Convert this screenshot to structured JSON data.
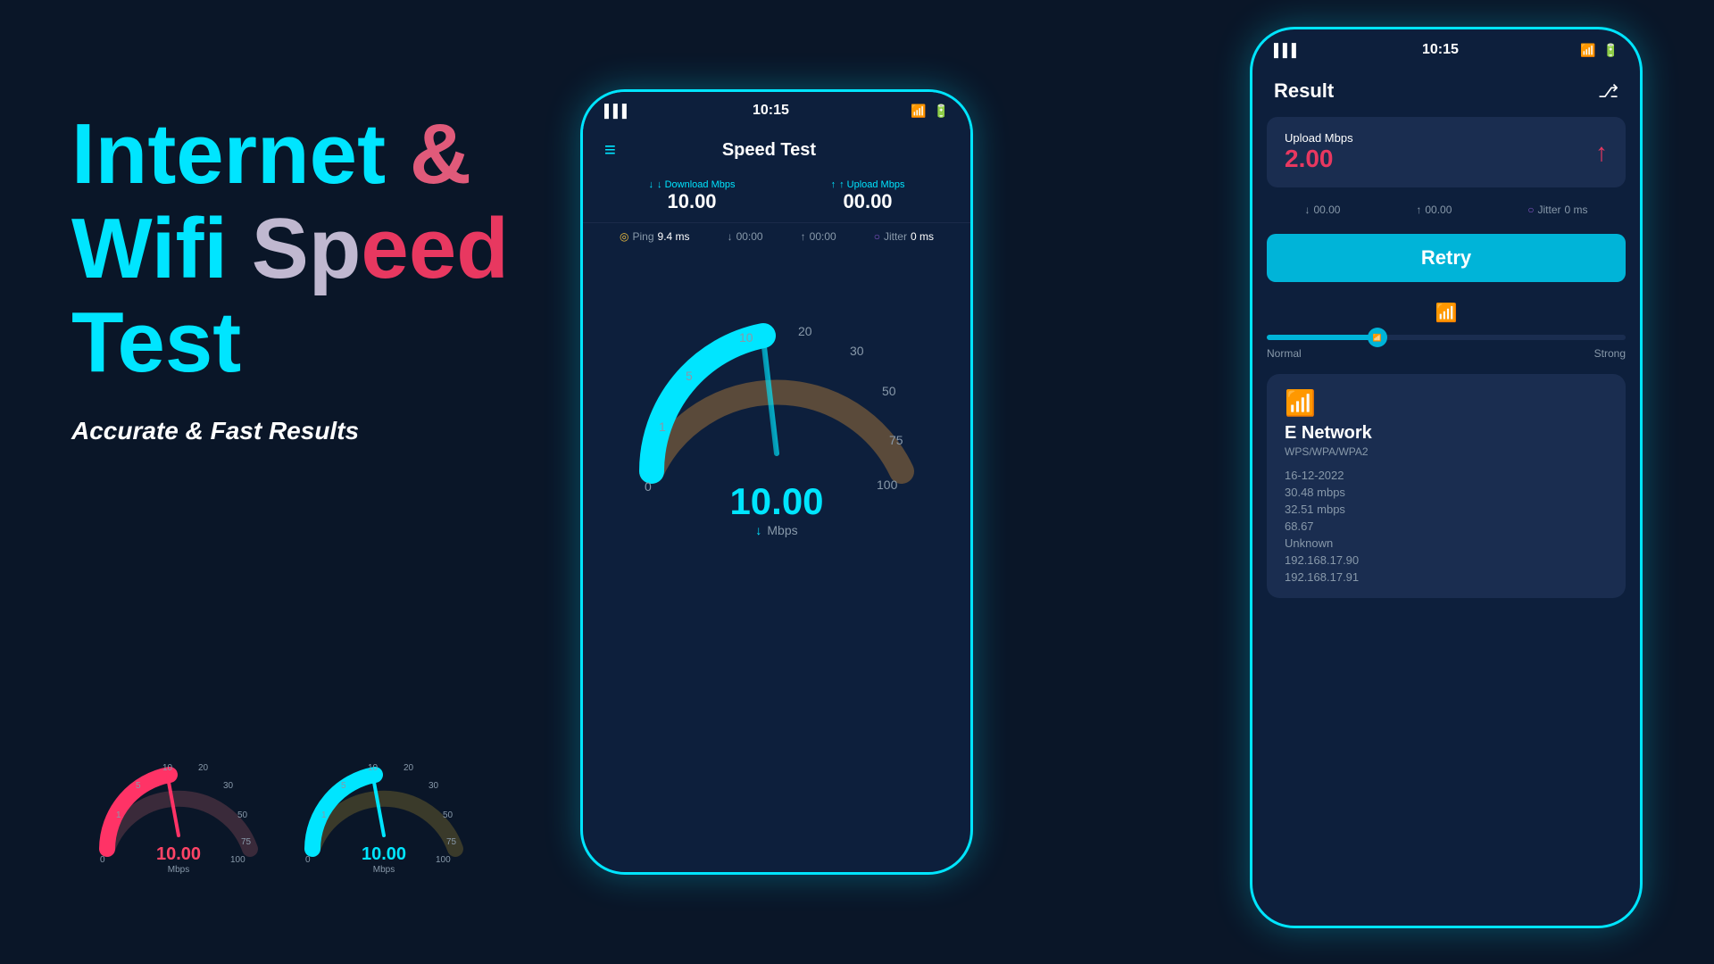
{
  "hero": {
    "line1_internet": "Internet ",
    "line1_amp": "&",
    "line2_wifi": "Wifi ",
    "line2_sp": "Sp",
    "line2_eed": "eed",
    "line3": "Test",
    "subtitle": "Accurate & Fast Results"
  },
  "phone_main": {
    "status_signal": "▌▌▌",
    "status_time": "10:15",
    "menu_label": "≡",
    "title": "Speed Test",
    "download_label": "↓ Download Mbps",
    "download_value": "10.00",
    "upload_label": "↑ Upload Mbps",
    "upload_value": "00.00",
    "ping_label": "Ping",
    "ping_value": "9.4 ms",
    "dl_small": "00:00",
    "ul_small": "00:00",
    "jitter_label": "Jitter",
    "jitter_value": "0 ms",
    "speed_number": "10.00",
    "speed_unit": "Mbps",
    "gauge_labels": [
      "0",
      "1",
      "5",
      "10",
      "20",
      "30",
      "50",
      "75",
      "100"
    ]
  },
  "phone_result": {
    "status_time": "10:15",
    "title": "Result",
    "upload_label": "Upload Mbps",
    "upload_value": "2.00",
    "dl_mini": "00.00",
    "ul_mini": "00.00",
    "jitter_label": "Jitter",
    "jitter_value": "0 ms",
    "retry_label": "Retry",
    "signal_normal": "Normal",
    "signal_strong": "Strong",
    "network_wifi_icon": "wifi",
    "network_name": "E Network",
    "network_type": "WPS/WPA/WPA2",
    "date": "16-12-2022",
    "download_speed": "30.48 mbps",
    "upload_speed": "32.51 mbps",
    "value1": "68.67",
    "value2": "Unknown",
    "ip1": "192.168.17.90",
    "ip2": "192.168.17.91"
  },
  "small_gauge1": {
    "value": "10.00",
    "unit": "Mbps",
    "color": "#ff4466"
  },
  "small_gauge2": {
    "value": "10.00",
    "unit": "Mbps",
    "color": "#00e5ff"
  }
}
